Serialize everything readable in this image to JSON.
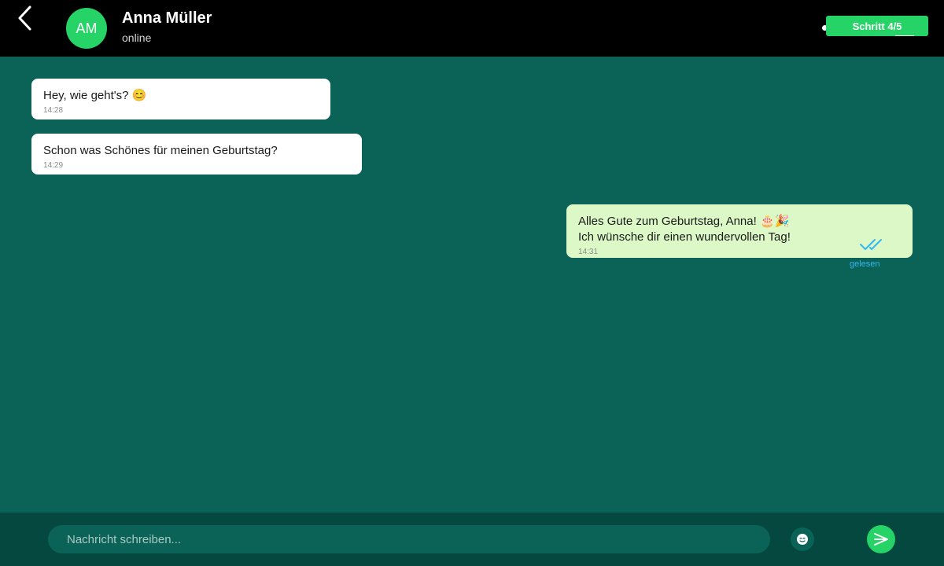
{
  "header": {
    "avatar_initials": "AM",
    "contact_name": "Anna Müller",
    "status": "online",
    "step_label": "Schritt 4/5"
  },
  "messages": [
    {
      "direction": "incoming",
      "text": "Hey, wie geht's? 😊",
      "time": "14:28"
    },
    {
      "direction": "incoming",
      "text": "Schon was Schönes für meinen Geburtstag?",
      "time": "14:29"
    },
    {
      "direction": "outgoing",
      "text": "Alles Gute zum Geburtstag, Anna! 🎂🎉\nIch wünsche dir einen wundervollen Tag!",
      "time": "14:31",
      "status": "gelesen"
    }
  ],
  "composer": {
    "placeholder": "Nachricht schreiben..."
  },
  "icons": {
    "back": "chevron-left-icon",
    "emoji": "smiley-icon",
    "send": "send-icon",
    "read": "double-check-icon"
  },
  "colors": {
    "header_bg": "#000000",
    "chat_bg": "#0b6357",
    "accent": "#25d366",
    "outgoing_bubble": "#dcf8c6",
    "read_ticks": "#34b7f1"
  }
}
